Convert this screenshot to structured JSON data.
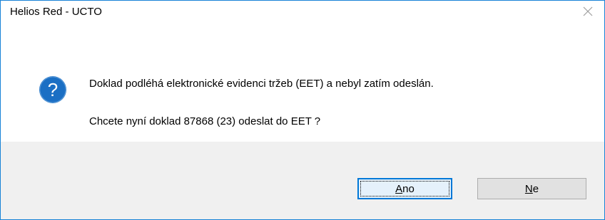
{
  "window": {
    "title": "Helios Red - UCTO",
    "close_glyph": "✕",
    "border_color": "#1883d7"
  },
  "message": {
    "icon": "question-icon",
    "icon_color": "#1b6fc4",
    "line1": "Doklad podléhá elektronické evidenci tržeb (EET) a nebyl zatím odeslán.",
    "line2": "Chcete nyní doklad 87868 (23) odeslat do EET ?"
  },
  "buttons": {
    "yes": {
      "accesskey": "A",
      "rest": "no"
    },
    "no": {
      "accesskey": "N",
      "rest": "e"
    }
  }
}
